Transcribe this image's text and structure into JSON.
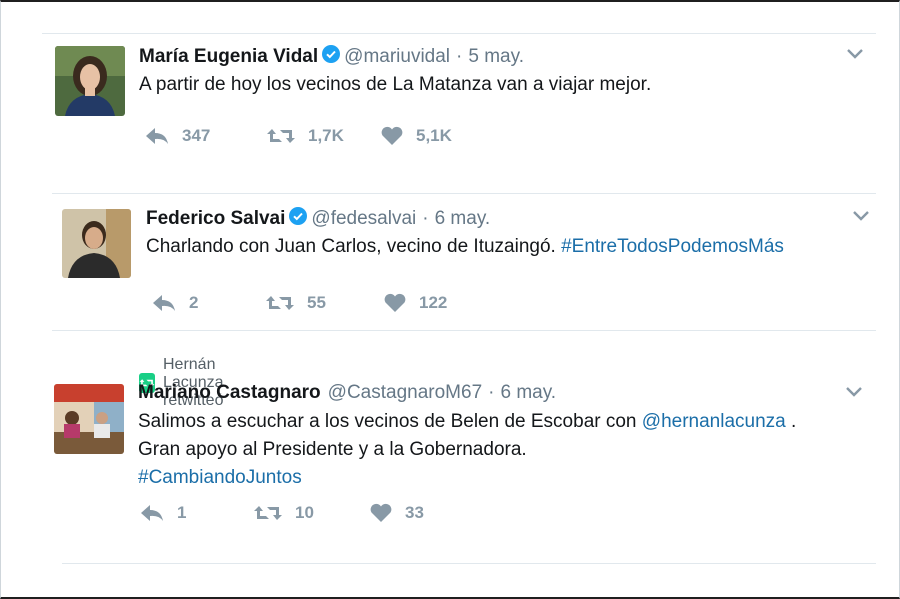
{
  "tweets": [
    {
      "name": "María Eugenia Vidal",
      "handle": "@mariuvidal",
      "separator": "·",
      "date": "5 may.",
      "text": "A partir de hoy los vecinos de La Matanza van a viajar mejor.",
      "replies": "347",
      "retweets": "1,7K",
      "likes": "5,1K"
    },
    {
      "name": "Federico Salvai",
      "handle": "@fedesalvai",
      "separator": "·",
      "date": "6 may.",
      "text_plain": "Charlando con Juan Carlos, vecino de Ituzaingó.",
      "hashtag": "#EntreTodosPodemosMás",
      "replies": "2",
      "retweets": "55",
      "likes": "122"
    },
    {
      "retweeted_by": "Hernán Lacunza retwitteó",
      "name": "Mariano Castagnaro",
      "handle": "@CastagnaroM67",
      "separator": "·",
      "date": "6 may.",
      "line1_plain": "Salimos a escuchar a los vecinos de Belen de Escobar con",
      "mention": "@hernanlacunza",
      "line1_end": ".",
      "line2": "Gran apoyo al Presidente y a la Gobernadora.",
      "hashtag": "#CambiandoJuntos",
      "replies": "1",
      "retweets": "10",
      "likes": "33"
    }
  ],
  "colors": {
    "name": "#14171a",
    "secondary": "#657786",
    "link": "#1b6ea8",
    "action_gray": "#8899a6",
    "verified": "#1da1f2",
    "retweet_green": "#19cf86"
  },
  "icons": [
    "verified-badge-icon",
    "chevron-down-icon",
    "reply-icon",
    "retweet-icon",
    "heart-icon"
  ]
}
